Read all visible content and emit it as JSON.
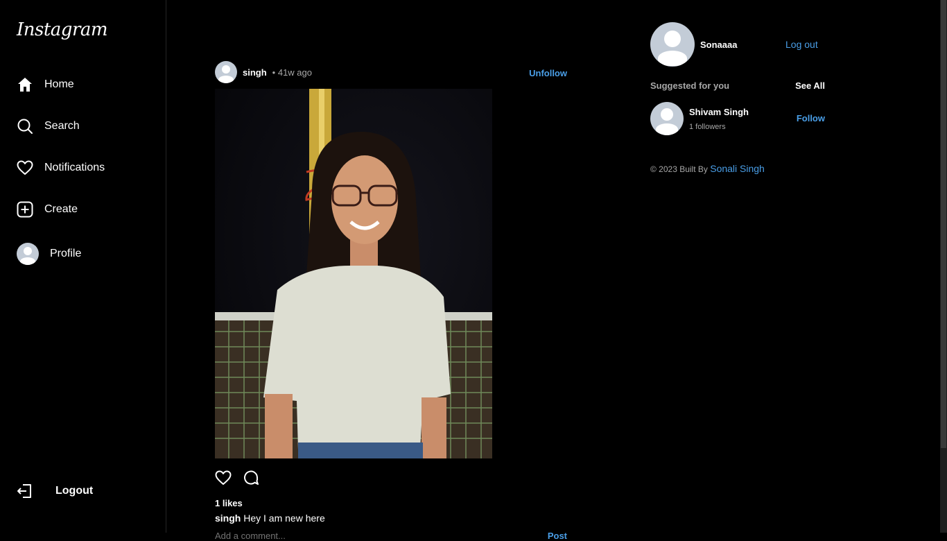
{
  "app": {
    "logo": "Instagram"
  },
  "nav": {
    "home": "Home",
    "search": "Search",
    "notifications": "Notifications",
    "create": "Create",
    "profile": "Profile",
    "logout": "Logout"
  },
  "post": {
    "username": "singh",
    "time": "• 41w ago",
    "unfollow": "Unfollow",
    "likes": "1 likes",
    "caption_user": "singh",
    "caption_text": "Hey I am new here",
    "comment_placeholder": "Add a comment...",
    "post_button": "Post"
  },
  "aside": {
    "me_name": "Sonaaaa",
    "logout": "Log out",
    "suggested_title": "Suggested for you",
    "see_all": "See All",
    "suggestions": [
      {
        "name": "Shivam Singh",
        "followers": "1 followers",
        "action": "Follow"
      }
    ],
    "footer_prefix": "© 2023 Built By",
    "footer_author": "Sonali Singh"
  },
  "colors": {
    "accent": "#4a9fe8",
    "background": "#000000",
    "muted": "#a8a8a8"
  }
}
